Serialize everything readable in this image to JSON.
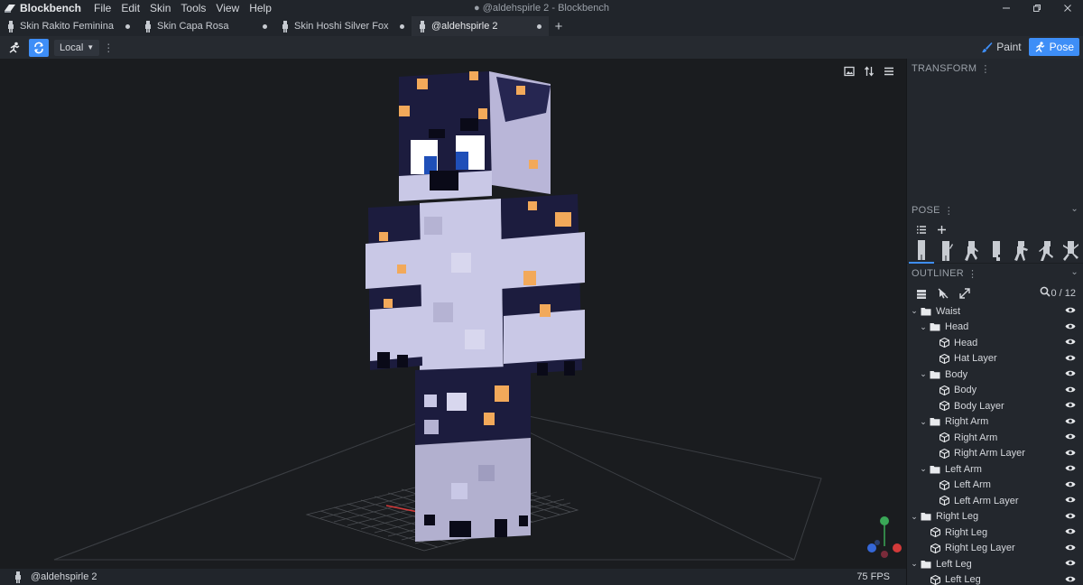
{
  "app": {
    "name": "Blockbench",
    "window_title": "● @aldehspirle 2 - Blockbench",
    "menu": [
      "File",
      "Edit",
      "Skin",
      "Tools",
      "View",
      "Help"
    ]
  },
  "tabs": [
    {
      "label": "Skin Rakito Feminina",
      "modified": true
    },
    {
      "label": "Skin Capa Rosa",
      "modified": true
    },
    {
      "label": "Skin Hoshi Silver Fox",
      "modified": true
    },
    {
      "label": "@aldehspirle 2",
      "modified": true,
      "active": true
    }
  ],
  "toolbar": {
    "space_select": "Local",
    "modes": [
      {
        "label": "Paint",
        "active": false
      },
      {
        "label": "Pose",
        "active": true
      }
    ]
  },
  "panels": {
    "transform_title": "TRANSFORM",
    "pose_title": "POSE",
    "outliner_title": "OUTLINER",
    "outliner_count": "0 / 12"
  },
  "outliner": [
    {
      "label": "Waist",
      "type": "group",
      "depth": 0
    },
    {
      "label": "Head",
      "type": "group",
      "depth": 1
    },
    {
      "label": "Head",
      "type": "cube",
      "depth": 2
    },
    {
      "label": "Hat Layer",
      "type": "cube",
      "depth": 2
    },
    {
      "label": "Body",
      "type": "group",
      "depth": 1
    },
    {
      "label": "Body",
      "type": "cube",
      "depth": 2
    },
    {
      "label": "Body Layer",
      "type": "cube",
      "depth": 2
    },
    {
      "label": "Right Arm",
      "type": "group",
      "depth": 1
    },
    {
      "label": "Right Arm",
      "type": "cube",
      "depth": 2
    },
    {
      "label": "Right Arm Layer",
      "type": "cube",
      "depth": 2
    },
    {
      "label": "Left Arm",
      "type": "group",
      "depth": 1
    },
    {
      "label": "Left Arm",
      "type": "cube",
      "depth": 2
    },
    {
      "label": "Left Arm Layer",
      "type": "cube",
      "depth": 2
    },
    {
      "label": "Right Leg",
      "type": "group",
      "depth": 0
    },
    {
      "label": "Right Leg",
      "type": "cube",
      "depth": 1
    },
    {
      "label": "Right Leg Layer",
      "type": "cube",
      "depth": 1
    },
    {
      "label": "Left Leg",
      "type": "group",
      "depth": 0
    },
    {
      "label": "Left Leg",
      "type": "cube",
      "depth": 1
    }
  ],
  "status": {
    "project_name": "@aldehspirle 2",
    "fps": "75 FPS"
  },
  "colors": {
    "accent": "#3e8ef7",
    "skin_dark": "#1c1c3e",
    "skin_light": "#c9c8e6",
    "skin_orange": "#f2a95a",
    "eye_blue": "#1f4fb8"
  }
}
